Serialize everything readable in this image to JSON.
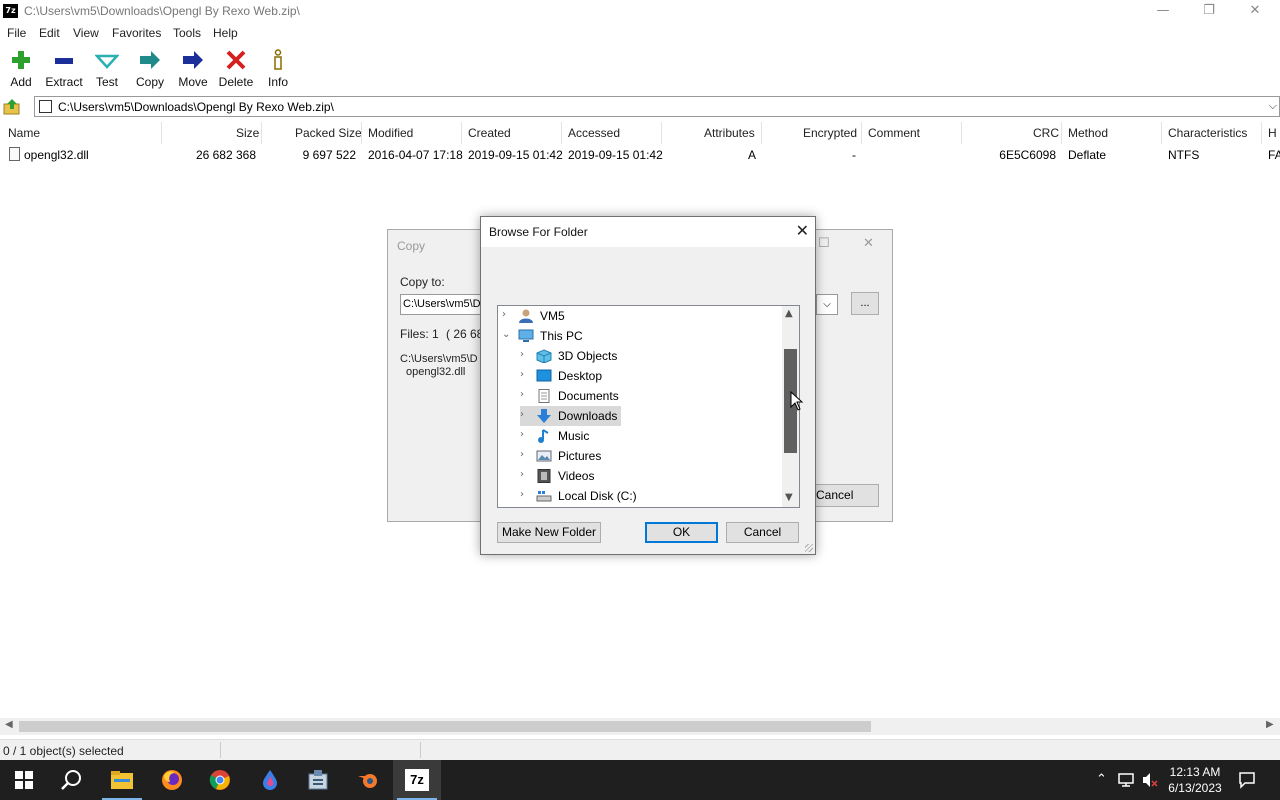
{
  "window": {
    "title": "C:\\Users\\vm5\\Downloads\\Opengl By Rexo Web.zip\\",
    "app_icon_text": "7z",
    "min_glyph": "—",
    "max_glyph": "❐",
    "close_glyph": "✕"
  },
  "menu": [
    "File",
    "Edit",
    "View",
    "Favorites",
    "Tools",
    "Help"
  ],
  "toolbar": [
    {
      "label": "Add",
      "icon": "plus-icon",
      "color": "#2ea02e"
    },
    {
      "label": "Extract",
      "icon": "minus-icon",
      "color": "#1a2f9a"
    },
    {
      "label": "Test",
      "icon": "check-icon",
      "color": "#2ab0b0"
    },
    {
      "label": "Copy",
      "icon": "copy-arrow-icon",
      "color": "#1e8a8a"
    },
    {
      "label": "Move",
      "icon": "move-arrow-icon",
      "color": "#1a2f9a"
    },
    {
      "label": "Delete",
      "icon": "delete-x-icon",
      "color": "#d42020"
    },
    {
      "label": "Info",
      "icon": "info-icon",
      "color": "#8a6a00"
    }
  ],
  "address": {
    "path": "C:\\Users\\vm5\\Downloads\\Opengl By Rexo Web.zip\\",
    "dropdown_glyph": "⌵"
  },
  "list": {
    "columns": [
      "Name",
      "Size",
      "Packed Size",
      "Modified",
      "Created",
      "Accessed",
      "Attributes",
      "Encrypted",
      "Comment",
      "CRC",
      "Method",
      "Characteristics",
      "H"
    ],
    "rows": [
      {
        "name": "opengl32.dll",
        "size": "26 682 368",
        "packed": "9 697 522",
        "modified": "2016-04-07 17:18",
        "created": "2019-09-15 01:42",
        "accessed": "2019-09-15 01:42",
        "attributes": "A",
        "encrypted": "-",
        "comment": "",
        "crc": "6E5C6098",
        "method": "Deflate",
        "characteristics": "NTFS",
        "h": "FA"
      }
    ]
  },
  "status": {
    "text": "0 / 1 object(s) selected"
  },
  "copy_dialog": {
    "title": "Copy",
    "copy_to_label": "Copy to:",
    "path_value": "C:\\Users\\vm5\\D",
    "files_label": "Files: 1",
    "files_size": "( 26 682",
    "source_path": "C:\\Users\\vm5\\D",
    "source_file": "opengl32.dll",
    "browse_label": "...",
    "cancel_label": "Cancel"
  },
  "browse_dialog": {
    "title": "Browse For Folder",
    "close_glyph": "✕",
    "tree": [
      {
        "label": "VM5",
        "icon": "user-icon",
        "level": 0,
        "expanded": false,
        "selected": false
      },
      {
        "label": "This PC",
        "icon": "computer-icon",
        "level": 0,
        "expanded": true,
        "selected": false
      },
      {
        "label": "3D Objects",
        "icon": "cube-icon",
        "level": 1,
        "expanded": false,
        "selected": false
      },
      {
        "label": "Desktop",
        "icon": "desktop-icon",
        "level": 1,
        "expanded": false,
        "selected": false
      },
      {
        "label": "Documents",
        "icon": "document-icon",
        "level": 1,
        "expanded": false,
        "selected": false
      },
      {
        "label": "Downloads",
        "icon": "download-icon",
        "level": 1,
        "expanded": false,
        "selected": true
      },
      {
        "label": "Music",
        "icon": "music-icon",
        "level": 1,
        "expanded": false,
        "selected": false
      },
      {
        "label": "Pictures",
        "icon": "pictures-icon",
        "level": 1,
        "expanded": false,
        "selected": false
      },
      {
        "label": "Videos",
        "icon": "video-icon",
        "level": 1,
        "expanded": false,
        "selected": false
      },
      {
        "label": "Local Disk (C:)",
        "icon": "disk-icon",
        "level": 1,
        "expanded": false,
        "selected": false
      }
    ],
    "make_new_folder": "Make New Folder",
    "ok": "OK",
    "cancel": "Cancel"
  },
  "taskbar": {
    "apps": [
      "windows-start-icon",
      "search-icon",
      "file-explorer-icon",
      "firefox-icon",
      "chrome-icon",
      "drop-app-icon",
      "tool-app-icon",
      "blender-icon",
      "7zip-icon"
    ],
    "active_app": "7zip-icon",
    "app_7z_text": "7z",
    "time": "12:13 AM",
    "date": "6/13/2023",
    "tray_chevron": "⌃"
  },
  "colors": {
    "accent": "#0078d7",
    "taskbar": "#1f1f1f",
    "dialog_bg": "#f0f0f0"
  }
}
